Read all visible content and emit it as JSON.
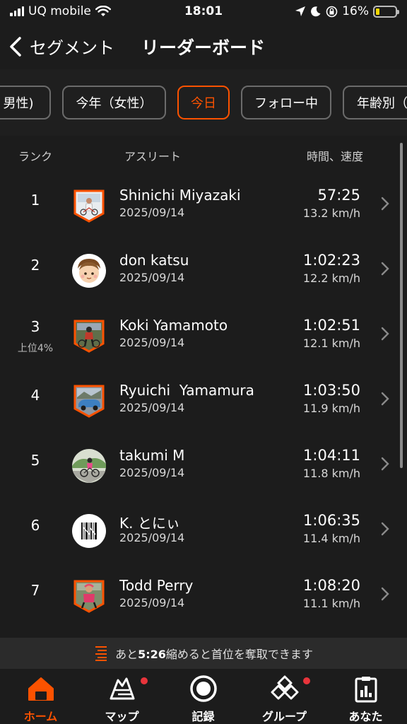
{
  "status": {
    "carrier": "UQ mobile",
    "time": "18:01",
    "battery": "16%"
  },
  "header": {
    "back_label": "セグメント",
    "title": "リーダーボード"
  },
  "filters": [
    {
      "label": "男性)"
    },
    {
      "label": "今年（女性）"
    },
    {
      "label": "今日",
      "active": true
    },
    {
      "label": "フォロー中"
    },
    {
      "label": "年齢別（"
    }
  ],
  "table": {
    "headers": {
      "rank": "ランク",
      "athlete": "アスリート",
      "result": "時間、速度"
    },
    "rows": [
      {
        "rank": "1",
        "sub": "",
        "name": "Shinichi Miyazaki",
        "date": "2025/09/14",
        "time": "57:25",
        "speed": "13.2 km/h",
        "avatar": "cyclist-photo"
      },
      {
        "rank": "2",
        "sub": "",
        "name": "don katsu",
        "date": "2025/09/14",
        "time": "1:02:23",
        "speed": "12.2 km/h",
        "avatar": "cartoon-face"
      },
      {
        "rank": "3",
        "sub": "上位4%",
        "name": "Koki Yamamoto",
        "date": "2025/09/14",
        "time": "1:02:51",
        "speed": "12.1 km/h",
        "avatar": "cyclist-photo"
      },
      {
        "rank": "4",
        "sub": "",
        "name": "Ryuichi  Yamamura",
        "date": "2025/09/14",
        "time": "1:03:50",
        "speed": "11.9 km/h",
        "avatar": "car-photo"
      },
      {
        "rank": "5",
        "sub": "",
        "name": "takumi M",
        "date": "2025/09/14",
        "time": "1:04:11",
        "speed": "11.8 km/h",
        "avatar": "cyclist-photo"
      },
      {
        "rank": "6",
        "sub": "",
        "name": "K. とにぃ",
        "date": "2025/09/14",
        "time": "1:06:35",
        "speed": "11.4 km/h",
        "avatar": "barcode"
      },
      {
        "rank": "7",
        "sub": "",
        "name": "Todd Perry",
        "date": "2025/09/14",
        "time": "1:08:20",
        "speed": "11.1 km/h",
        "avatar": "cyclist-photo"
      }
    ]
  },
  "notice": {
    "prefix": "あと",
    "value": "5:26",
    "suffix": "縮めると首位を奪取できます"
  },
  "nav": [
    {
      "label": "ホーム",
      "icon": "home-icon",
      "active": true
    },
    {
      "label": "マップ",
      "icon": "map-icon",
      "badge": true
    },
    {
      "label": "記録",
      "icon": "record-icon"
    },
    {
      "label": "グループ",
      "icon": "groups-icon",
      "badge": true
    },
    {
      "label": "あなた",
      "icon": "you-icon"
    }
  ],
  "colors": {
    "accent": "#fc5200",
    "background": "#1c1c1c",
    "badge": "#e8343b"
  }
}
